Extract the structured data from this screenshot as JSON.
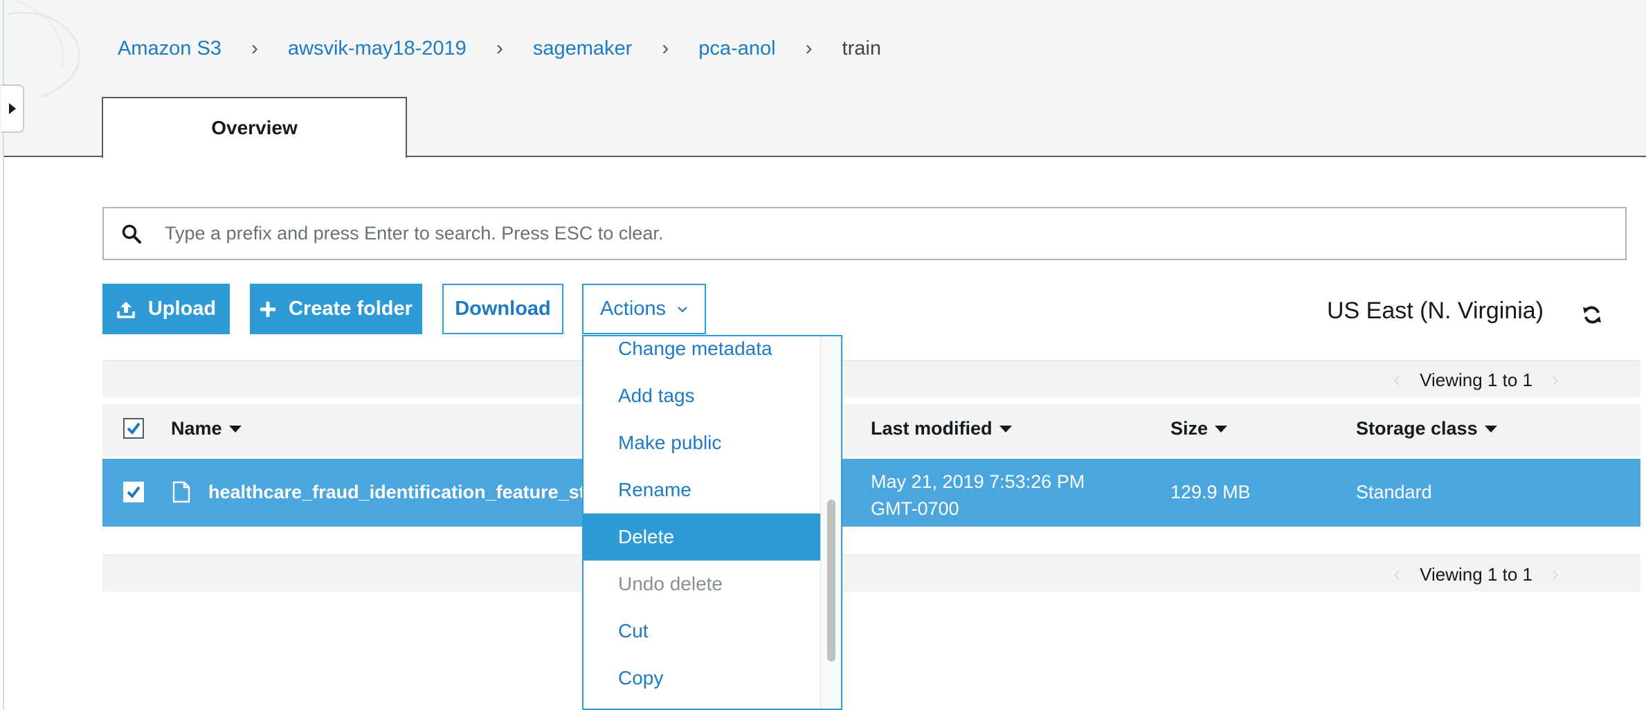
{
  "breadcrumb": {
    "items": [
      "Amazon S3",
      "awsvik-may18-2019",
      "sagemaker",
      "pca-anol"
    ],
    "current": "train",
    "separator": "›"
  },
  "tabs": [
    {
      "label": "Overview",
      "active": true
    }
  ],
  "search": {
    "placeholder": "Type a prefix and press Enter to search. Press ESC to clear.",
    "value": ""
  },
  "toolbar": {
    "upload_label": "Upload",
    "create_folder_label": "Create folder",
    "download_label": "Download",
    "actions_label": "Actions"
  },
  "region": "US East (N. Virginia)",
  "pagination": {
    "label": "Viewing 1 to 1"
  },
  "table": {
    "columns": [
      "Name",
      "Last modified",
      "Size",
      "Storage class"
    ],
    "rows": [
      {
        "name": "healthcare_fraud_identification_feature_st",
        "last_modified_line1": "May 21, 2019 7:53:26 PM",
        "last_modified_line2": "GMT-0700",
        "size": "129.9 MB",
        "storage_class": "Standard",
        "selected": true
      }
    ]
  },
  "actions_menu": {
    "items": [
      {
        "label": "Change metadata",
        "state": "normal"
      },
      {
        "label": "Add tags",
        "state": "normal"
      },
      {
        "label": "Make public",
        "state": "normal"
      },
      {
        "label": "Rename",
        "state": "normal"
      },
      {
        "label": "Delete",
        "state": "selected"
      },
      {
        "label": "Undo delete",
        "state": "disabled"
      },
      {
        "label": "Cut",
        "state": "normal"
      },
      {
        "label": "Copy",
        "state": "normal"
      }
    ]
  },
  "colors": {
    "accent": "#2e9ad6",
    "link": "#1f7bc1",
    "row_selected": "#4ba6dd",
    "header_bg": "#f4f5f5"
  }
}
